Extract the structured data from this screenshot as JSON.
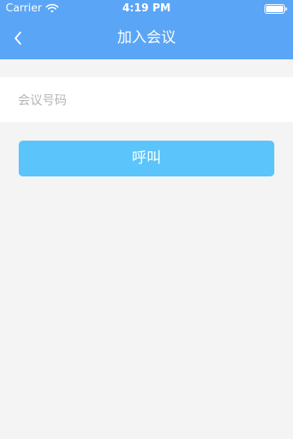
{
  "status_bar": {
    "carrier": "Carrier",
    "time": "4:19 PM",
    "wifi_icon": "wifi-icon",
    "battery_icon": "battery-icon"
  },
  "nav": {
    "back_icon": "chevron-left-icon",
    "title": "加入会议"
  },
  "form": {
    "meeting_number_value": "",
    "meeting_number_placeholder": "会议号码",
    "call_button_label": "呼叫"
  },
  "colors": {
    "header_background": "#5aa5f6",
    "button_background": "#5bc4fb",
    "page_background": "#f4f4f4",
    "placeholder_text": "#b5b5b5"
  }
}
